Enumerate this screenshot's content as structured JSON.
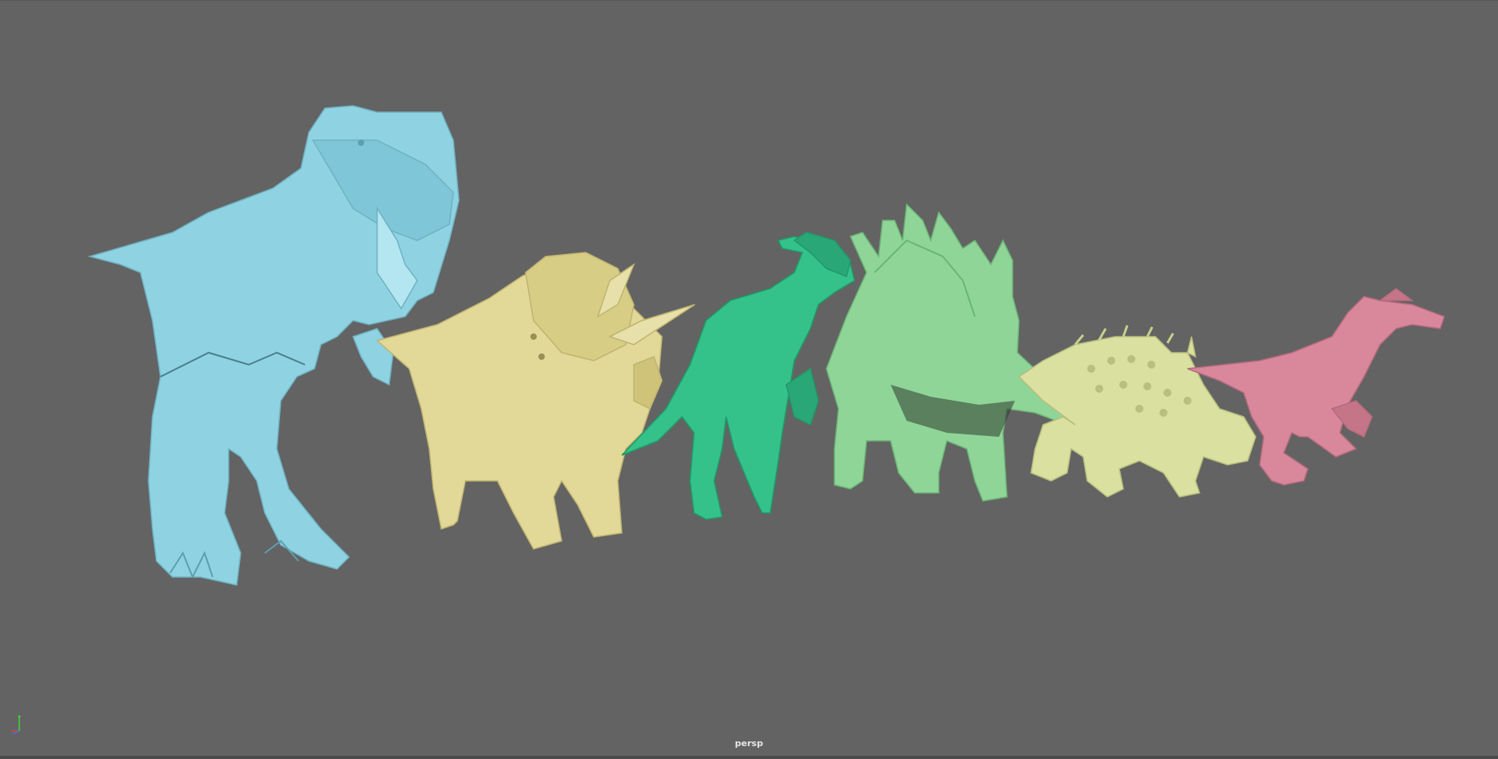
{
  "viewport": {
    "camera_name": "persp",
    "background_color": "#636363"
  },
  "axis_gizmo": {
    "icon": "axis-gizmo-icon",
    "x_color": "#e04040",
    "y_color": "#3fd43f",
    "z_color": "#4a6cf0"
  },
  "models": [
    {
      "name": "tyrannosaurus",
      "icon": "tyrannosaurus-model",
      "color": "#8fd3e3"
    },
    {
      "name": "triceratops",
      "icon": "triceratops-model",
      "color": "#e2d898"
    },
    {
      "name": "parasaurolophus",
      "icon": "parasaurolophus-model",
      "color": "#34c28a"
    },
    {
      "name": "stegosaurus",
      "icon": "stegosaurus-model",
      "color": "#8fd598"
    },
    {
      "name": "ankylosaurus",
      "icon": "ankylosaurus-model",
      "color": "#d9e0a0"
    },
    {
      "name": "velociraptor",
      "icon": "velociraptor-model",
      "color": "#d9889c"
    }
  ]
}
